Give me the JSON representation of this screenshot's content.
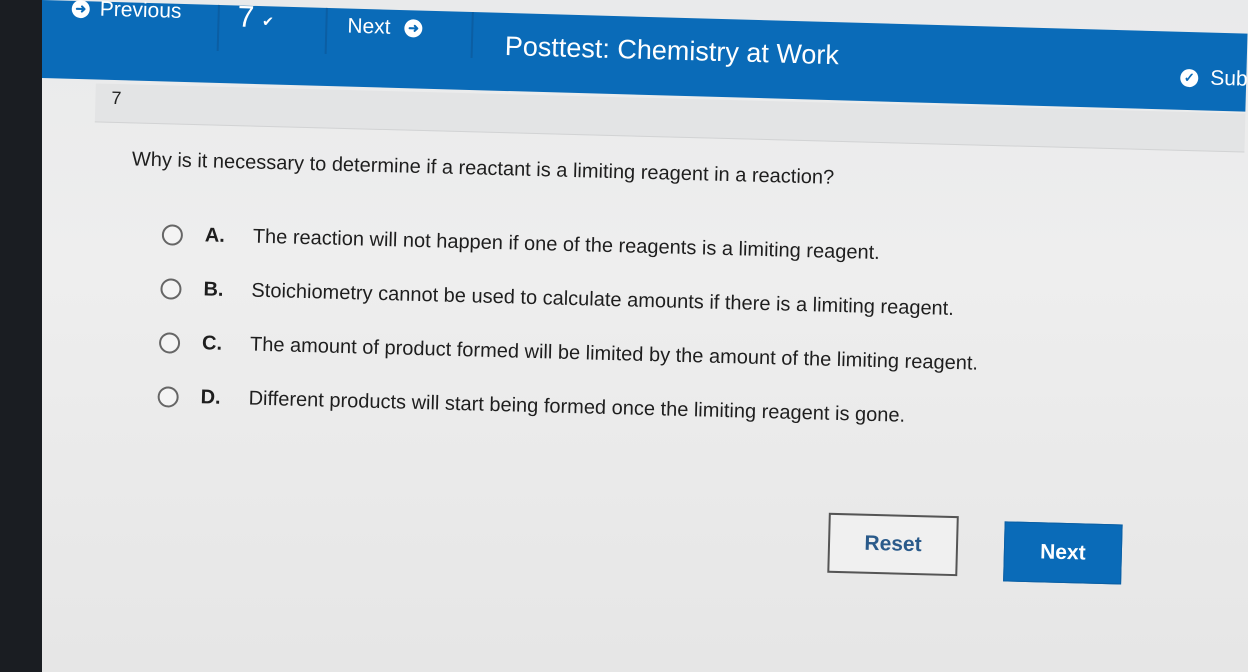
{
  "nav": {
    "previous_label": "Previous",
    "question_number": "7",
    "next_label": "Next"
  },
  "header": {
    "title": "Posttest: Chemistry at Work",
    "submit_label": "Sub"
  },
  "question": {
    "number": "7",
    "text": "Why is it necessary to determine if a reactant is a limiting reagent in a reaction?",
    "options": [
      {
        "letter": "A.",
        "text": "The reaction will not happen if one of the reagents is a limiting reagent."
      },
      {
        "letter": "B.",
        "text": "Stoichiometry cannot be used to calculate amounts if there is a limiting reagent."
      },
      {
        "letter": "C.",
        "text": "The amount of product formed will be limited by the amount of the limiting reagent."
      },
      {
        "letter": "D.",
        "text": "Different products will start being formed once the limiting reagent is gone."
      }
    ]
  },
  "buttons": {
    "reset_label": "Reset",
    "next_label": "Next"
  },
  "colors": {
    "accent": "#0a6bb8",
    "background": "#e9eaeb"
  },
  "icons": {
    "previous": "arrow-left-circle-icon",
    "next": "arrow-right-circle-icon",
    "dropdown": "chevron-down-icon",
    "submit": "check-circle-icon"
  }
}
